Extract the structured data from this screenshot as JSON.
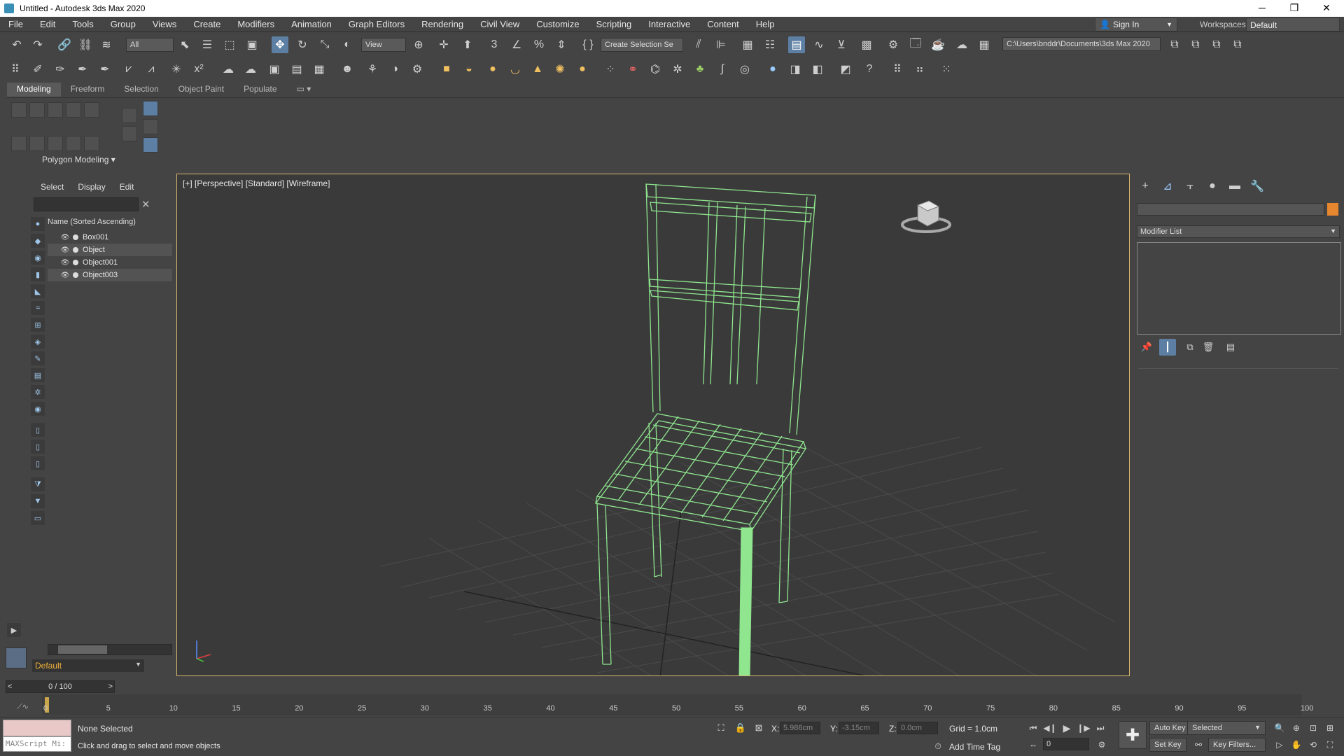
{
  "window": {
    "title": "Untitled - Autodesk 3ds Max 2020",
    "minimize": "─",
    "restore": "❐",
    "close": "✕"
  },
  "menu": [
    "File",
    "Edit",
    "Tools",
    "Group",
    "Views",
    "Create",
    "Modifiers",
    "Animation",
    "Graph Editors",
    "Rendering",
    "Civil View",
    "Customize",
    "Scripting",
    "Interactive",
    "Content",
    "Help"
  ],
  "account": {
    "sign_in": "Sign In",
    "workspaces_label": "Workspaces:",
    "workspace": "Default"
  },
  "toolbar": {
    "filter": "All",
    "view": "View",
    "selection_set": "Create Selection Se",
    "project_path": "C:\\Users\\bnddr\\Documents\\3ds Max 2020"
  },
  "ribbon": {
    "tabs": [
      "Modeling",
      "Freeform",
      "Selection",
      "Object Paint",
      "Populate"
    ],
    "panel_label": "Polygon Modeling ▾"
  },
  "explorer": {
    "tabs": [
      "Select",
      "Display",
      "Edit"
    ],
    "header": "Name (Sorted Ascending)",
    "items": [
      "Box001",
      "Object",
      "Object001",
      "Object003"
    ],
    "layer": "Default"
  },
  "viewport": {
    "label": "[+] [Perspective] [Standard] [Wireframe]"
  },
  "command_panel": {
    "modifier_list": "Modifier List"
  },
  "timeline": {
    "frame": "0 / 100",
    "ticks": [
      "0",
      "5",
      "10",
      "15",
      "20",
      "25",
      "30",
      "35",
      "40",
      "45",
      "50",
      "55",
      "60",
      "65",
      "70",
      "75",
      "80",
      "85",
      "90",
      "95",
      "100"
    ]
  },
  "status": {
    "maxscript": "MAXScript Mi:",
    "selection": "None Selected",
    "prompt": "Click and drag to select and move objects",
    "x_label": "X:",
    "x_value": "5.986cm",
    "y_label": "Y:",
    "y_value": "-3.15cm",
    "z_label": "Z:",
    "z_value": "0.0cm",
    "grid": "Grid = 1.0cm",
    "add_time_tag": "Add Time Tag",
    "auto_key": "Auto Key",
    "set_key": "Set Key",
    "key_mode": "Selected",
    "key_filters": "Key Filters...",
    "frame_field": "0"
  },
  "colors": {
    "wireframe": "#8fe68f",
    "accent_orange": "#e6862e",
    "viewport_border": "#d7b56d"
  }
}
